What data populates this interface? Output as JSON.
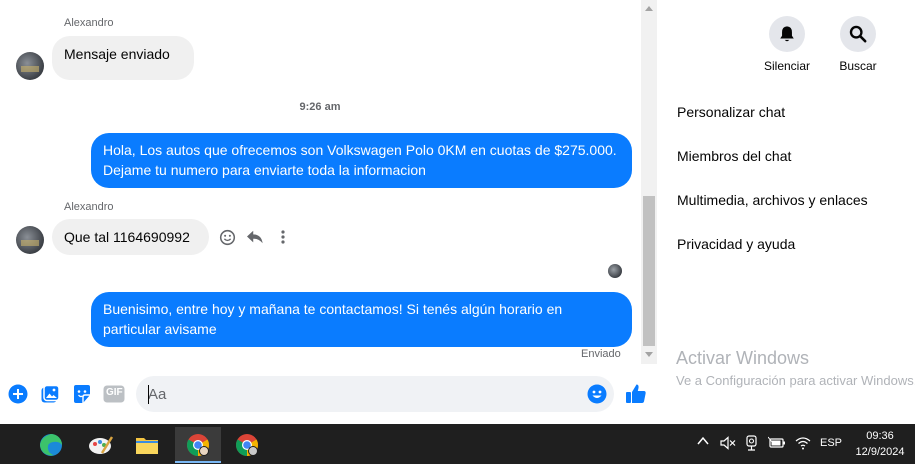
{
  "chat": {
    "messages": [
      {
        "sender": "Alexandro",
        "text": "Mensaje enviado"
      },
      {
        "timestamp": "9:26 am"
      },
      {
        "text": "Hola, Los autos que ofrecemos son Volkswagen Polo 0KM en cuotas de $275.000. Dejame tu numero para enviarte toda la informacion"
      },
      {
        "sender": "Alexandro",
        "text": "Que tal 1164690992"
      },
      {
        "text": "Buenisimo, entre hoy y mañana te contactamos! Si tenés algún horario en particular avisame"
      }
    ],
    "sent_status": "Enviado"
  },
  "composer": {
    "placeholder": "Aa",
    "gif_label": "GIF"
  },
  "panel": {
    "mute_label": "Silenciar",
    "search_label": "Buscar",
    "menu": [
      "Personalizar chat",
      "Miembros del chat",
      "Multimedia, archivos y enlaces",
      "Privacidad y ayuda"
    ]
  },
  "watermark": {
    "title": "Activar Windows",
    "subtitle": "Ve a Configuración para activar Windows."
  },
  "taskbar": {
    "language": "ESP",
    "time": "09:36",
    "date": "12/9/2024"
  },
  "colors": {
    "accent": "#0a7cff",
    "incoming_bubble": "#f0f0f0",
    "taskbar": "#1f1f1f"
  }
}
